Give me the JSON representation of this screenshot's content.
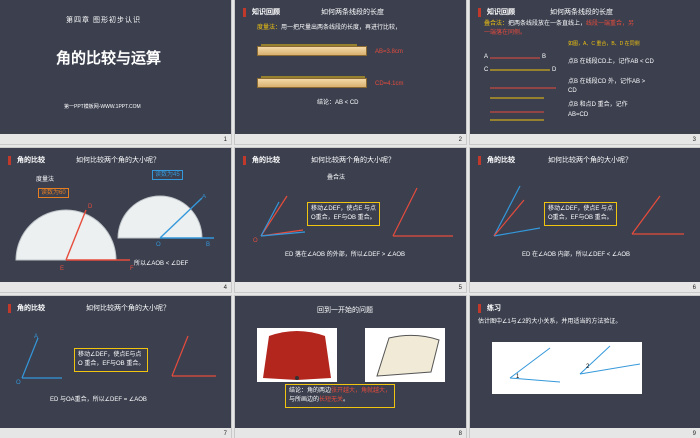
{
  "slides": [
    {
      "num": "1",
      "chapter": "第四章 图形初步认识",
      "title": "角的比较与运算",
      "footer": "第一PPT模板网-WWW.1PPT.COM"
    },
    {
      "num": "2",
      "tag": "知识回顾",
      "heading": "如何两条线段的长度",
      "method_label": "度量法：",
      "method_text": "用一把尺量出两条线段的长度，再进行比较，",
      "ab": "AB=3.8cm",
      "cd": "CD=4.1cm",
      "conclusion": "结论：AB < CD"
    },
    {
      "num": "3",
      "tag": "知识回顾",
      "heading": "如何两条线段的长度",
      "line1a": "叠合法：",
      "line1b": "把两条线段放在一条直线上，",
      "line1c": "线段一端重合，另",
      "line2": "一端落在同侧。",
      "note": "如图，A、C 重合，B、D 在同侧",
      "r1": "点B 在线段CD上，记作AB < CD",
      "r2": "点B 在线段CD 外，记作AB >",
      "r2b": "CD",
      "r3": "点B 和点D 重合，记作",
      "r3b": "AB=CD",
      "labels": [
        "A",
        "B",
        "C",
        "D"
      ]
    },
    {
      "num": "4",
      "tag": "角的比较",
      "heading": "如何比较两个角的大小呢？",
      "method": "度量法",
      "read60": "读数为60",
      "read45": "读数为45",
      "result": "所以∠AOB < ∠DEF",
      "labels": {
        "A": "A",
        "O": "O",
        "B": "B",
        "D": "D",
        "E": "E",
        "F": "F"
      }
    },
    {
      "num": "5",
      "tag": "角的比较",
      "heading": "如何比较两个角的大小呢？",
      "method": "叠合法",
      "callout1": "移动∠DEF，使点E 与点",
      "callout2": "O重合，EF与OB 重合。",
      "result": "ED 落在∠AOB 的外部，所以∠DEF > ∠AOB"
    },
    {
      "num": "6",
      "tag": "角的比较",
      "heading": "如何比较两个角的大小呢？",
      "callout1": "移动∠DEF，使点E 与点",
      "callout2": "O重合，EF与OB 重合。",
      "result": "ED 在∠AOB 内部，所以∠DEF < ∠AOB"
    },
    {
      "num": "7",
      "tag": "角的比较",
      "heading": "如何比较两个角的大小呢？",
      "callout1": "移动∠DEF，使点E与点",
      "callout2": "O 重合，EF与OB 重合。",
      "result": "ED 与OA重合，所以∠DEF = ∠AOB"
    },
    {
      "num": "8",
      "heading": "回到一开始的问题",
      "c1a": "结论：角的两边",
      "c1b": "张开越大，",
      "c1c": "角就越大，",
      "c2a": "与所画边的",
      "c2b": "长短无关",
      "c2c": "。"
    },
    {
      "num": "9",
      "tag": "练习",
      "text": "估计图中∠1与∠2的大小关系，并用适当的方法验证。",
      "l1": "1",
      "l2": "2"
    }
  ]
}
